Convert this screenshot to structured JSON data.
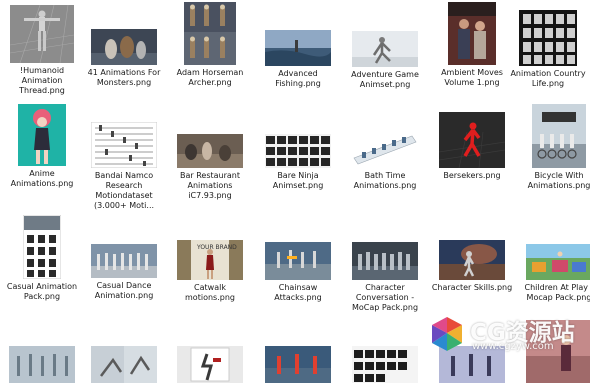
{
  "files": [
    {
      "name": "!Humanoid Animation Thread.png",
      "lines": [
        "!Humanoid",
        "Animation",
        "Thread.png"
      ]
    },
    {
      "name": "41 Animations For Monsters.png",
      "lines": [
        "41 Animations For",
        "Monsters.png"
      ]
    },
    {
      "name": "Adam Horseman Archer.png",
      "lines": [
        "Adam Horseman",
        "Archer.png"
      ]
    },
    {
      "name": "Advanced Fishing.png",
      "lines": [
        "Advanced",
        "Fishing.png"
      ]
    },
    {
      "name": "Adventure Game Animset.png",
      "lines": [
        "Adventure Game",
        "Animset.png"
      ]
    },
    {
      "name": "Ambient Moves Volume 1.png",
      "lines": [
        "Ambient Moves",
        "Volume 1.png"
      ]
    },
    {
      "name": "Animation Country Life.png",
      "lines": [
        "Animation Country",
        "Life.png"
      ]
    },
    {
      "name": "Anime Animations.png",
      "lines": [
        "Anime",
        "Animations.png"
      ]
    },
    {
      "name": "Bandai Namco Research Motiondataset (3.000+ Moti...",
      "lines": [
        "Bandai Namco",
        "Research",
        "Motiondataset",
        "(3.000+ Moti..."
      ]
    },
    {
      "name": "Bar Restaurant Animations iC7.93.png",
      "lines": [
        "Bar Restaurant",
        "Animations",
        "iC7.93.png"
      ]
    },
    {
      "name": "Bare Ninja Animset.png",
      "lines": [
        "Bare Ninja",
        "Animset.png"
      ]
    },
    {
      "name": "Bath Time Animations.png",
      "lines": [
        "Bath Time",
        "Animations.png"
      ]
    },
    {
      "name": "Bersekers.png",
      "lines": [
        "Bersekers.png"
      ]
    },
    {
      "name": "Bicycle With Animations.png",
      "lines": [
        "Bicycle With",
        "Animations.png"
      ]
    },
    {
      "name": "Casual Animation Pack.png",
      "lines": [
        "Casual Animation",
        "Pack.png"
      ]
    },
    {
      "name": "Casual Dance Animation.png",
      "lines": [
        "Casual Dance",
        "Animation.png"
      ]
    },
    {
      "name": "Catwalk motions.png",
      "lines": [
        "Catwalk",
        "motions.png"
      ]
    },
    {
      "name": "Chainsaw Attacks.png",
      "lines": [
        "Chainsaw",
        "Attacks.png"
      ]
    },
    {
      "name": "Character Conversation - MoCap Pack.png",
      "lines": [
        "Character",
        "Conversation -",
        "MoCap Pack.png"
      ]
    },
    {
      "name": "Character Skills.png",
      "lines": [
        "Character Skills.png"
      ]
    },
    {
      "name": "Children At Play - Mocap Pack.png",
      "lines": [
        "Children At Play -",
        "Mocap Pack.png"
      ]
    }
  ],
  "watermark": {
    "text": "CG资源站",
    "url": "www.cgzyw.com"
  }
}
